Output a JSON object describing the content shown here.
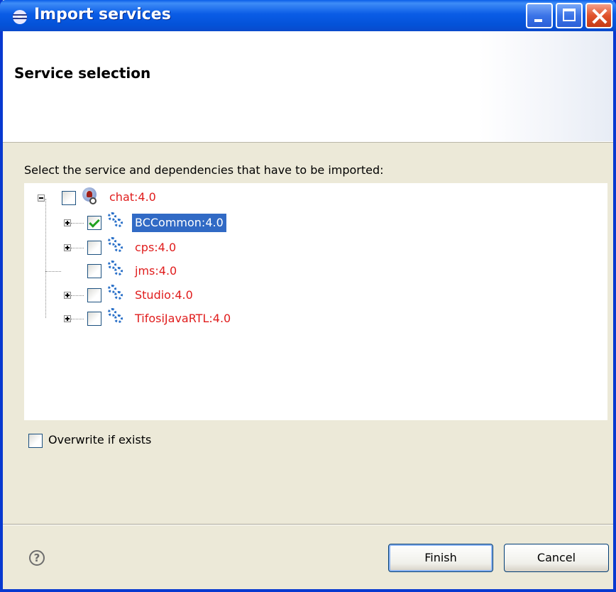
{
  "window": {
    "title": "Import services",
    "controls": [
      "minimize",
      "maximize",
      "close"
    ]
  },
  "header": {
    "title": "Service selection"
  },
  "main": {
    "instruction": "Select the service and dependencies that have to be imported:",
    "tree": {
      "root": {
        "label": "chat:4.0",
        "checked": false,
        "expanded": true,
        "icon": "web-service-icon"
      },
      "children": [
        {
          "label": "BCCommon:4.0",
          "checked": true,
          "has_children": true,
          "selected": true,
          "icon": "gears-icon"
        },
        {
          "label": "cps:4.0",
          "checked": false,
          "has_children": true,
          "selected": false,
          "icon": "gears-icon"
        },
        {
          "label": "jms:4.0",
          "checked": false,
          "has_children": false,
          "selected": false,
          "icon": "gears-icon"
        },
        {
          "label": "Studio:4.0",
          "checked": false,
          "has_children": true,
          "selected": false,
          "icon": "gears-icon"
        },
        {
          "label": "TifosiJavaRTL:4.0",
          "checked": false,
          "has_children": true,
          "selected": false,
          "icon": "gears-icon"
        }
      ]
    },
    "overwrite": {
      "label": "Overwrite if exists",
      "checked": false
    }
  },
  "footer": {
    "help_glyph": "?",
    "finish_label": "Finish",
    "cancel_label": "Cancel"
  },
  "colors": {
    "titlebar": "#0a5ce6",
    "tree_label": "#e01c1c",
    "selection": "#316ac5",
    "dialog_bg": "#ece9d8"
  }
}
